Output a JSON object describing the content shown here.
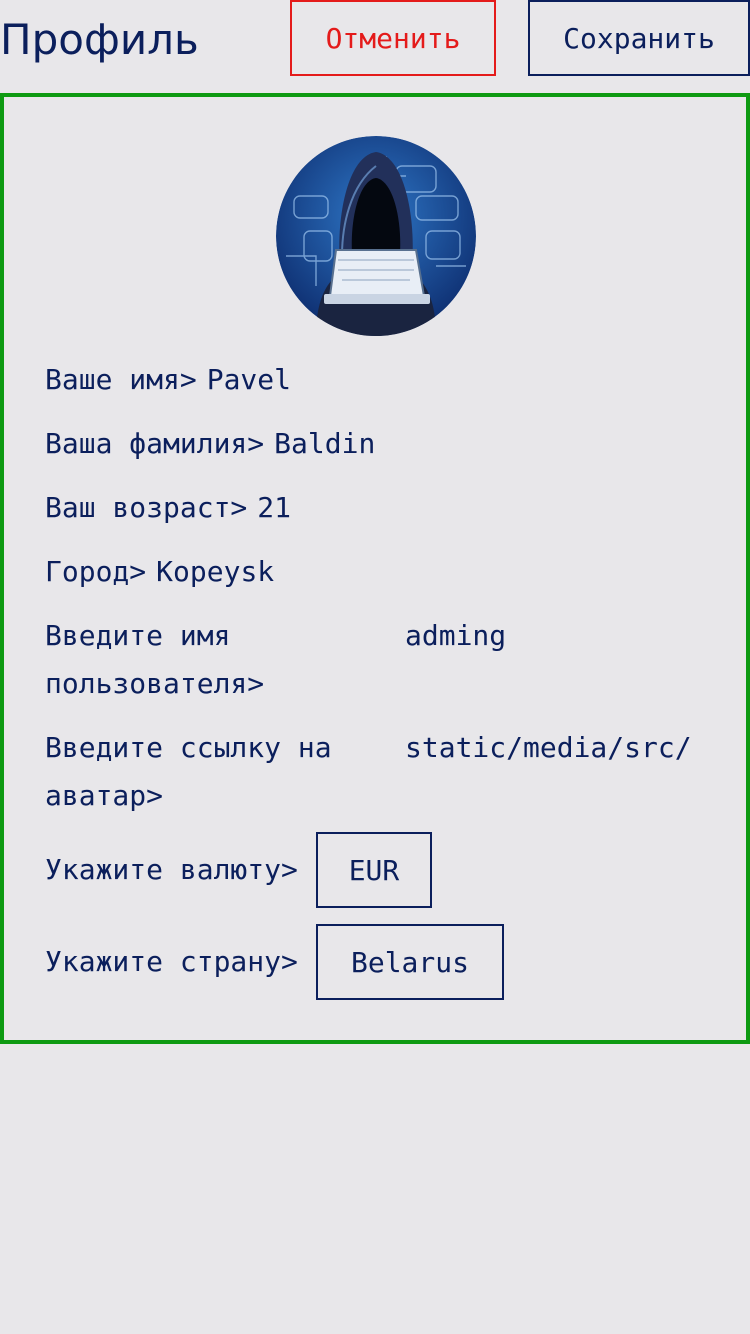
{
  "header": {
    "title": "Профиль",
    "cancel_label": "Отменить",
    "save_label": "Сохранить"
  },
  "colors": {
    "text": "#0b1f5c",
    "cancel": "#e41b1b",
    "panel_border": "#0e9a12",
    "background": "#e8e7ea"
  },
  "profile": {
    "avatar": "hooded-hacker-avatar",
    "first_name_label": "Ваше имя>",
    "first_name": "Pavel",
    "last_name_label": "Ваша фамилия>",
    "last_name": "Baldin",
    "age_label": "Ваш возраст>",
    "age": "21",
    "city_label": "Город>",
    "city": "Kopeysk",
    "username_label": "Введите имя пользователя>",
    "username": "adming",
    "avatar_link_label": "Введите ссылку на аватар>",
    "avatar_link": "static/media/src/",
    "currency_label": "Укажите валюту>",
    "currency": "EUR",
    "country_label": "Укажите страну>",
    "country": "Belarus"
  }
}
